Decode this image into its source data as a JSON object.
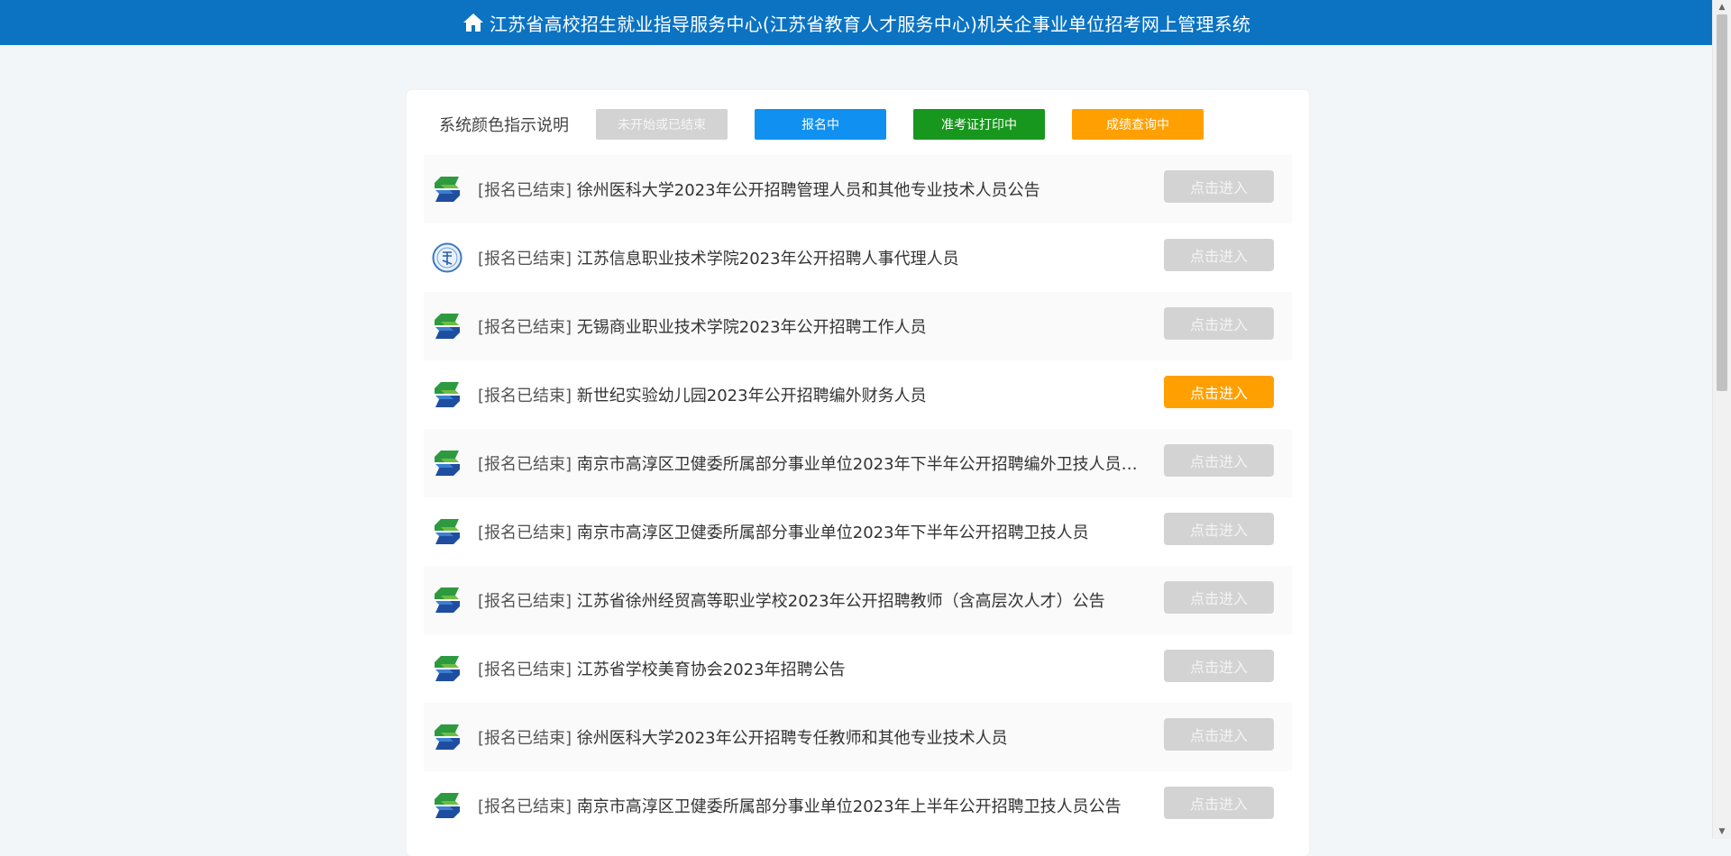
{
  "header": {
    "title": "江苏省高校招生就业指导服务中心(江苏省教育人才服务中心)机关企事业单位招考网上管理系统"
  },
  "legend": {
    "label": "系统颜色指示说明",
    "items": [
      {
        "label": "未开始或已结束",
        "color": "#d3d3d3"
      },
      {
        "label": "报名中",
        "color": "#1090f0"
      },
      {
        "label": "准考证打印中",
        "color": "#18971e"
      },
      {
        "label": "成绩查询中",
        "color": "#ffa000"
      }
    ]
  },
  "rows": [
    {
      "status": "[报名已结束]",
      "title": "徐州医科大学2023年公开招聘管理人员和其他专业技术人员公告",
      "button": "点击进入",
      "logo": "s-logo-icon"
    },
    {
      "status": "[报名已结束]",
      "title": "江苏信息职业技术学院2023年公开招聘人事代理人员",
      "button": "点击进入",
      "logo": "school-seal-icon"
    },
    {
      "status": "[报名已结束]",
      "title": "无锡商业职业技术学院2023年公开招聘工作人员",
      "button": "点击进入",
      "logo": "s-logo-icon"
    },
    {
      "status": "[报名已结束]",
      "title": "新世纪实验幼儿园2023年公开招聘编外财务人员",
      "button": "点击进入",
      "logo": "s-logo-icon"
    },
    {
      "status": "[报名已结束]",
      "title": "南京市高淳区卫健委所属部分事业单位2023年下半年公开招聘编外卫技人员、…",
      "button": "点击进入",
      "logo": "s-logo-icon"
    },
    {
      "status": "[报名已结束]",
      "title": "南京市高淳区卫健委所属部分事业单位2023年下半年公开招聘卫技人员",
      "button": "点击进入",
      "logo": "s-logo-icon"
    },
    {
      "status": "[报名已结束]",
      "title": "江苏省徐州经贸高等职业学校2023年公开招聘教师（含高层次人才）公告",
      "button": "点击进入",
      "logo": "s-logo-icon"
    },
    {
      "status": "[报名已结束]",
      "title": "江苏省学校美育协会2023年招聘公告",
      "button": "点击进入",
      "logo": "s-logo-icon"
    },
    {
      "status": "[报名已结束]",
      "title": "徐州医科大学2023年公开招聘专任教师和其他专业技术人员",
      "button": "点击进入",
      "logo": "s-logo-icon"
    },
    {
      "status": "[报名已结束]",
      "title": "南京市高淳区卫健委所属部分事业单位2023年上半年公开招聘卫技人员公告",
      "button": "点击进入",
      "logo": "s-logo-icon"
    }
  ]
}
